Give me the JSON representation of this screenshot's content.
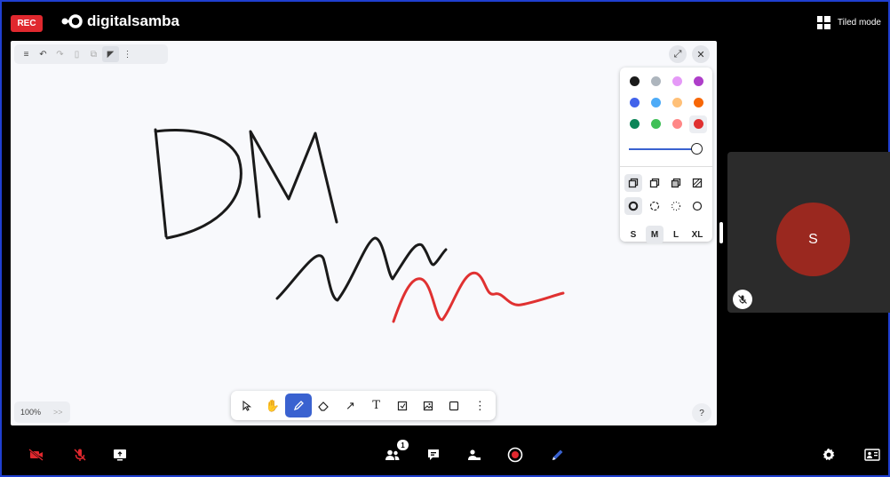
{
  "header": {
    "rec_label": "REC",
    "brand": "digitalsamba",
    "layout_label": "Tiled mode"
  },
  "whiteboard": {
    "toolbar_icons": [
      "menu-icon",
      "undo-icon",
      "redo-icon",
      "delete-icon",
      "duplicate-icon",
      "send-to-back-icon",
      "more-icon"
    ],
    "zoom_level": "100%",
    "zoom_more": ">>",
    "help_label": "?",
    "palette": {
      "colors": [
        "#1a1a1a",
        "#adb5bd",
        "#e599f7",
        "#ae3ec9",
        "#4263eb",
        "#4dabf7",
        "#ffc078",
        "#f76707",
        "#0c8558",
        "#40c057",
        "#ff8787",
        "#e03131"
      ],
      "selected_color": "#e03131",
      "sizes": [
        "S",
        "M",
        "L",
        "XL"
      ],
      "selected_size": "M"
    },
    "tools": [
      "select-icon",
      "hand-icon",
      "draw-icon",
      "eraser-icon",
      "arrow-icon",
      "text-icon",
      "note-icon",
      "image-icon",
      "rectangle-icon",
      "more-icon"
    ],
    "active_tool": "draw-icon",
    "stroke_colors": {
      "ink": "#1a1a1a",
      "red": "#e03131"
    }
  },
  "participant": {
    "initial": "S",
    "avatar_color": "#9a281f"
  },
  "bottom_bar": {
    "participants_count": "1",
    "accent_red": "#e0282e",
    "accent_blue": "#3a62d0"
  }
}
